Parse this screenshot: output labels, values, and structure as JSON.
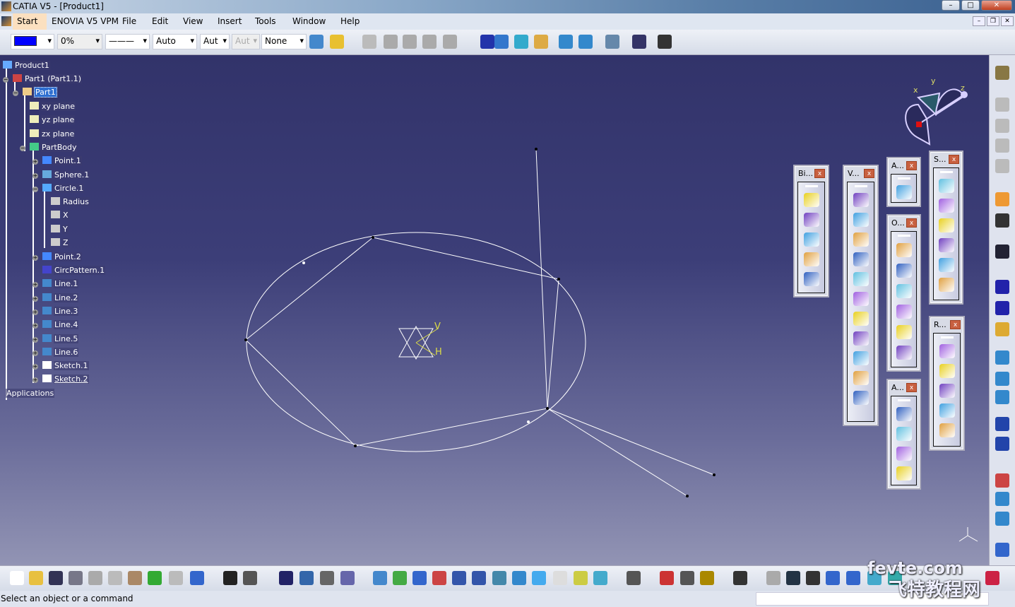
{
  "window": {
    "title": "CATIA V5 - [Product1]",
    "controls": [
      "–",
      "□",
      "✕"
    ]
  },
  "menu": {
    "items": [
      "Start",
      "ENOVIA V5 VPM",
      "File",
      "Edit",
      "View",
      "Insert",
      "Tools",
      "Window",
      "Help"
    ],
    "mdi_controls": [
      "–",
      "❐",
      "✕"
    ]
  },
  "properties_toolbar": {
    "color": "#0000ff",
    "transparency": "0%",
    "line_type": "———",
    "thickness": "Auto",
    "linetype2": "Aut",
    "weight": "Aut",
    "layer": "None"
  },
  "tree": {
    "items": [
      {
        "label": "Product1",
        "icon": "product-icon"
      },
      {
        "label": "Part1 (Part1.1)",
        "icon": "part-instance-icon"
      },
      {
        "label": "Part1",
        "icon": "part-icon",
        "selected": true
      },
      {
        "label": "xy plane",
        "icon": "plane-icon"
      },
      {
        "label": "yz plane",
        "icon": "plane-icon"
      },
      {
        "label": "zx plane",
        "icon": "plane-icon"
      },
      {
        "label": "PartBody",
        "icon": "body-icon"
      },
      {
        "label": "Point.1",
        "icon": "point-icon"
      },
      {
        "label": "Sphere.1",
        "icon": "sphere-icon"
      },
      {
        "label": "Circle.1",
        "icon": "circle-icon"
      },
      {
        "label": "Radius",
        "icon": "parameter-icon"
      },
      {
        "label": "X",
        "icon": "parameter-icon"
      },
      {
        "label": "Y",
        "icon": "parameter-icon"
      },
      {
        "label": "Z",
        "icon": "parameter-icon"
      },
      {
        "label": "Point.2",
        "icon": "point-icon"
      },
      {
        "label": "CircPattern.1",
        "icon": "pattern-icon"
      },
      {
        "label": "Line.1",
        "icon": "line-icon"
      },
      {
        "label": "Line.2",
        "icon": "line-icon"
      },
      {
        "label": "Line.3",
        "icon": "line-icon"
      },
      {
        "label": "Line.4",
        "icon": "line-icon"
      },
      {
        "label": "Line.5",
        "icon": "line-icon"
      },
      {
        "label": "Line.6",
        "icon": "line-icon"
      },
      {
        "label": "Sketch.1",
        "icon": "sketch-icon"
      },
      {
        "label": "Sketch.2",
        "icon": "sketch-icon"
      },
      {
        "label": "Applications",
        "icon": ""
      }
    ]
  },
  "compass": {
    "x": "x",
    "y": "y",
    "z": "z"
  },
  "axis_marker": {
    "v": "V",
    "h": "H"
  },
  "floating_toolbars": [
    {
      "title": "Bi...",
      "icons": [
        "boundary-icon",
        "extract-icon",
        "fill-icon",
        "blend-icon",
        "healing-icon"
      ]
    },
    {
      "title": "V...",
      "icons": [
        "pad-icon",
        "multi-pad-icon",
        "pocket-icon",
        "shaft-icon",
        "groove-icon",
        "hole-icon",
        "rib-icon",
        "slot-icon",
        "stiffener-icon",
        "loft-icon",
        "remove-loft-icon"
      ]
    },
    {
      "title": "A...",
      "icons": [
        "analysis-icon"
      ]
    },
    {
      "title": "O...",
      "icons": [
        "split-icon",
        "trim-icon",
        "join-icon",
        "offset-icon",
        "translate-icon",
        "extrapolate-icon"
      ]
    },
    {
      "title": "A...",
      "icons": [
        "adaptive-sweep-icon",
        "sweep-icon",
        "multisection-icon",
        "spine-icon"
      ]
    },
    {
      "title": "S...",
      "icons": [
        "sphere-icon",
        "revolve-icon",
        "extrude-icon",
        "cylinder-icon",
        "offset-surface-icon",
        "sweep-surface-icon"
      ]
    },
    {
      "title": "R...",
      "icons": [
        "repetition-icon",
        "pattern-icon",
        "scaling-icon",
        "symmetry-icon",
        "axis-system-icon"
      ]
    }
  ],
  "status": {
    "message": "Select an object or a command",
    "command_input": ""
  },
  "watermark": {
    "url": "fevte.com",
    "cn": "飞特教程网"
  },
  "colors": {
    "viewport_top": "#32336a",
    "viewport_bottom": "#9294b4",
    "geometry": "#ffffff"
  }
}
